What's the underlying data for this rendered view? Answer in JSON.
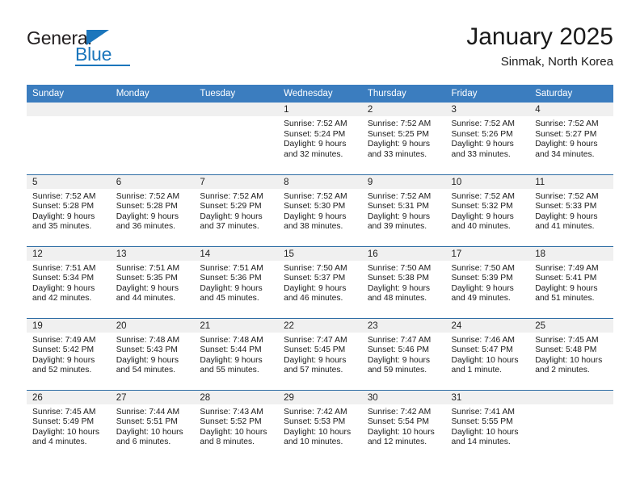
{
  "brand": {
    "name_top": "General",
    "name_bottom": "Blue",
    "accent_color": "#1b76bc"
  },
  "header": {
    "title": "January 2025",
    "subtitle": "Sinmak, North Korea"
  },
  "calendar": {
    "header_bg": "#3b7dbf",
    "row_rule_color": "#2e6da4",
    "daynum_bg": "#f0f0f0",
    "weekday_headers": [
      "Sunday",
      "Monday",
      "Tuesday",
      "Wednesday",
      "Thursday",
      "Friday",
      "Saturday"
    ],
    "weeks": [
      [
        {
          "day": "",
          "lines": []
        },
        {
          "day": "",
          "lines": []
        },
        {
          "day": "",
          "lines": []
        },
        {
          "day": "1",
          "lines": [
            "Sunrise: 7:52 AM",
            "Sunset: 5:24 PM",
            "Daylight: 9 hours",
            "and 32 minutes."
          ]
        },
        {
          "day": "2",
          "lines": [
            "Sunrise: 7:52 AM",
            "Sunset: 5:25 PM",
            "Daylight: 9 hours",
            "and 33 minutes."
          ]
        },
        {
          "day": "3",
          "lines": [
            "Sunrise: 7:52 AM",
            "Sunset: 5:26 PM",
            "Daylight: 9 hours",
            "and 33 minutes."
          ]
        },
        {
          "day": "4",
          "lines": [
            "Sunrise: 7:52 AM",
            "Sunset: 5:27 PM",
            "Daylight: 9 hours",
            "and 34 minutes."
          ]
        }
      ],
      [
        {
          "day": "5",
          "lines": [
            "Sunrise: 7:52 AM",
            "Sunset: 5:28 PM",
            "Daylight: 9 hours",
            "and 35 minutes."
          ]
        },
        {
          "day": "6",
          "lines": [
            "Sunrise: 7:52 AM",
            "Sunset: 5:28 PM",
            "Daylight: 9 hours",
            "and 36 minutes."
          ]
        },
        {
          "day": "7",
          "lines": [
            "Sunrise: 7:52 AM",
            "Sunset: 5:29 PM",
            "Daylight: 9 hours",
            "and 37 minutes."
          ]
        },
        {
          "day": "8",
          "lines": [
            "Sunrise: 7:52 AM",
            "Sunset: 5:30 PM",
            "Daylight: 9 hours",
            "and 38 minutes."
          ]
        },
        {
          "day": "9",
          "lines": [
            "Sunrise: 7:52 AM",
            "Sunset: 5:31 PM",
            "Daylight: 9 hours",
            "and 39 minutes."
          ]
        },
        {
          "day": "10",
          "lines": [
            "Sunrise: 7:52 AM",
            "Sunset: 5:32 PM",
            "Daylight: 9 hours",
            "and 40 minutes."
          ]
        },
        {
          "day": "11",
          "lines": [
            "Sunrise: 7:52 AM",
            "Sunset: 5:33 PM",
            "Daylight: 9 hours",
            "and 41 minutes."
          ]
        }
      ],
      [
        {
          "day": "12",
          "lines": [
            "Sunrise: 7:51 AM",
            "Sunset: 5:34 PM",
            "Daylight: 9 hours",
            "and 42 minutes."
          ]
        },
        {
          "day": "13",
          "lines": [
            "Sunrise: 7:51 AM",
            "Sunset: 5:35 PM",
            "Daylight: 9 hours",
            "and 44 minutes."
          ]
        },
        {
          "day": "14",
          "lines": [
            "Sunrise: 7:51 AM",
            "Sunset: 5:36 PM",
            "Daylight: 9 hours",
            "and 45 minutes."
          ]
        },
        {
          "day": "15",
          "lines": [
            "Sunrise: 7:50 AM",
            "Sunset: 5:37 PM",
            "Daylight: 9 hours",
            "and 46 minutes."
          ]
        },
        {
          "day": "16",
          "lines": [
            "Sunrise: 7:50 AM",
            "Sunset: 5:38 PM",
            "Daylight: 9 hours",
            "and 48 minutes."
          ]
        },
        {
          "day": "17",
          "lines": [
            "Sunrise: 7:50 AM",
            "Sunset: 5:39 PM",
            "Daylight: 9 hours",
            "and 49 minutes."
          ]
        },
        {
          "day": "18",
          "lines": [
            "Sunrise: 7:49 AM",
            "Sunset: 5:41 PM",
            "Daylight: 9 hours",
            "and 51 minutes."
          ]
        }
      ],
      [
        {
          "day": "19",
          "lines": [
            "Sunrise: 7:49 AM",
            "Sunset: 5:42 PM",
            "Daylight: 9 hours",
            "and 52 minutes."
          ]
        },
        {
          "day": "20",
          "lines": [
            "Sunrise: 7:48 AM",
            "Sunset: 5:43 PM",
            "Daylight: 9 hours",
            "and 54 minutes."
          ]
        },
        {
          "day": "21",
          "lines": [
            "Sunrise: 7:48 AM",
            "Sunset: 5:44 PM",
            "Daylight: 9 hours",
            "and 55 minutes."
          ]
        },
        {
          "day": "22",
          "lines": [
            "Sunrise: 7:47 AM",
            "Sunset: 5:45 PM",
            "Daylight: 9 hours",
            "and 57 minutes."
          ]
        },
        {
          "day": "23",
          "lines": [
            "Sunrise: 7:47 AM",
            "Sunset: 5:46 PM",
            "Daylight: 9 hours",
            "and 59 minutes."
          ]
        },
        {
          "day": "24",
          "lines": [
            "Sunrise: 7:46 AM",
            "Sunset: 5:47 PM",
            "Daylight: 10 hours",
            "and 1 minute."
          ]
        },
        {
          "day": "25",
          "lines": [
            "Sunrise: 7:45 AM",
            "Sunset: 5:48 PM",
            "Daylight: 10 hours",
            "and 2 minutes."
          ]
        }
      ],
      [
        {
          "day": "26",
          "lines": [
            "Sunrise: 7:45 AM",
            "Sunset: 5:49 PM",
            "Daylight: 10 hours",
            "and 4 minutes."
          ]
        },
        {
          "day": "27",
          "lines": [
            "Sunrise: 7:44 AM",
            "Sunset: 5:51 PM",
            "Daylight: 10 hours",
            "and 6 minutes."
          ]
        },
        {
          "day": "28",
          "lines": [
            "Sunrise: 7:43 AM",
            "Sunset: 5:52 PM",
            "Daylight: 10 hours",
            "and 8 minutes."
          ]
        },
        {
          "day": "29",
          "lines": [
            "Sunrise: 7:42 AM",
            "Sunset: 5:53 PM",
            "Daylight: 10 hours",
            "and 10 minutes."
          ]
        },
        {
          "day": "30",
          "lines": [
            "Sunrise: 7:42 AM",
            "Sunset: 5:54 PM",
            "Daylight: 10 hours",
            "and 12 minutes."
          ]
        },
        {
          "day": "31",
          "lines": [
            "Sunrise: 7:41 AM",
            "Sunset: 5:55 PM",
            "Daylight: 10 hours",
            "and 14 minutes."
          ]
        },
        {
          "day": "",
          "lines": []
        }
      ]
    ]
  }
}
